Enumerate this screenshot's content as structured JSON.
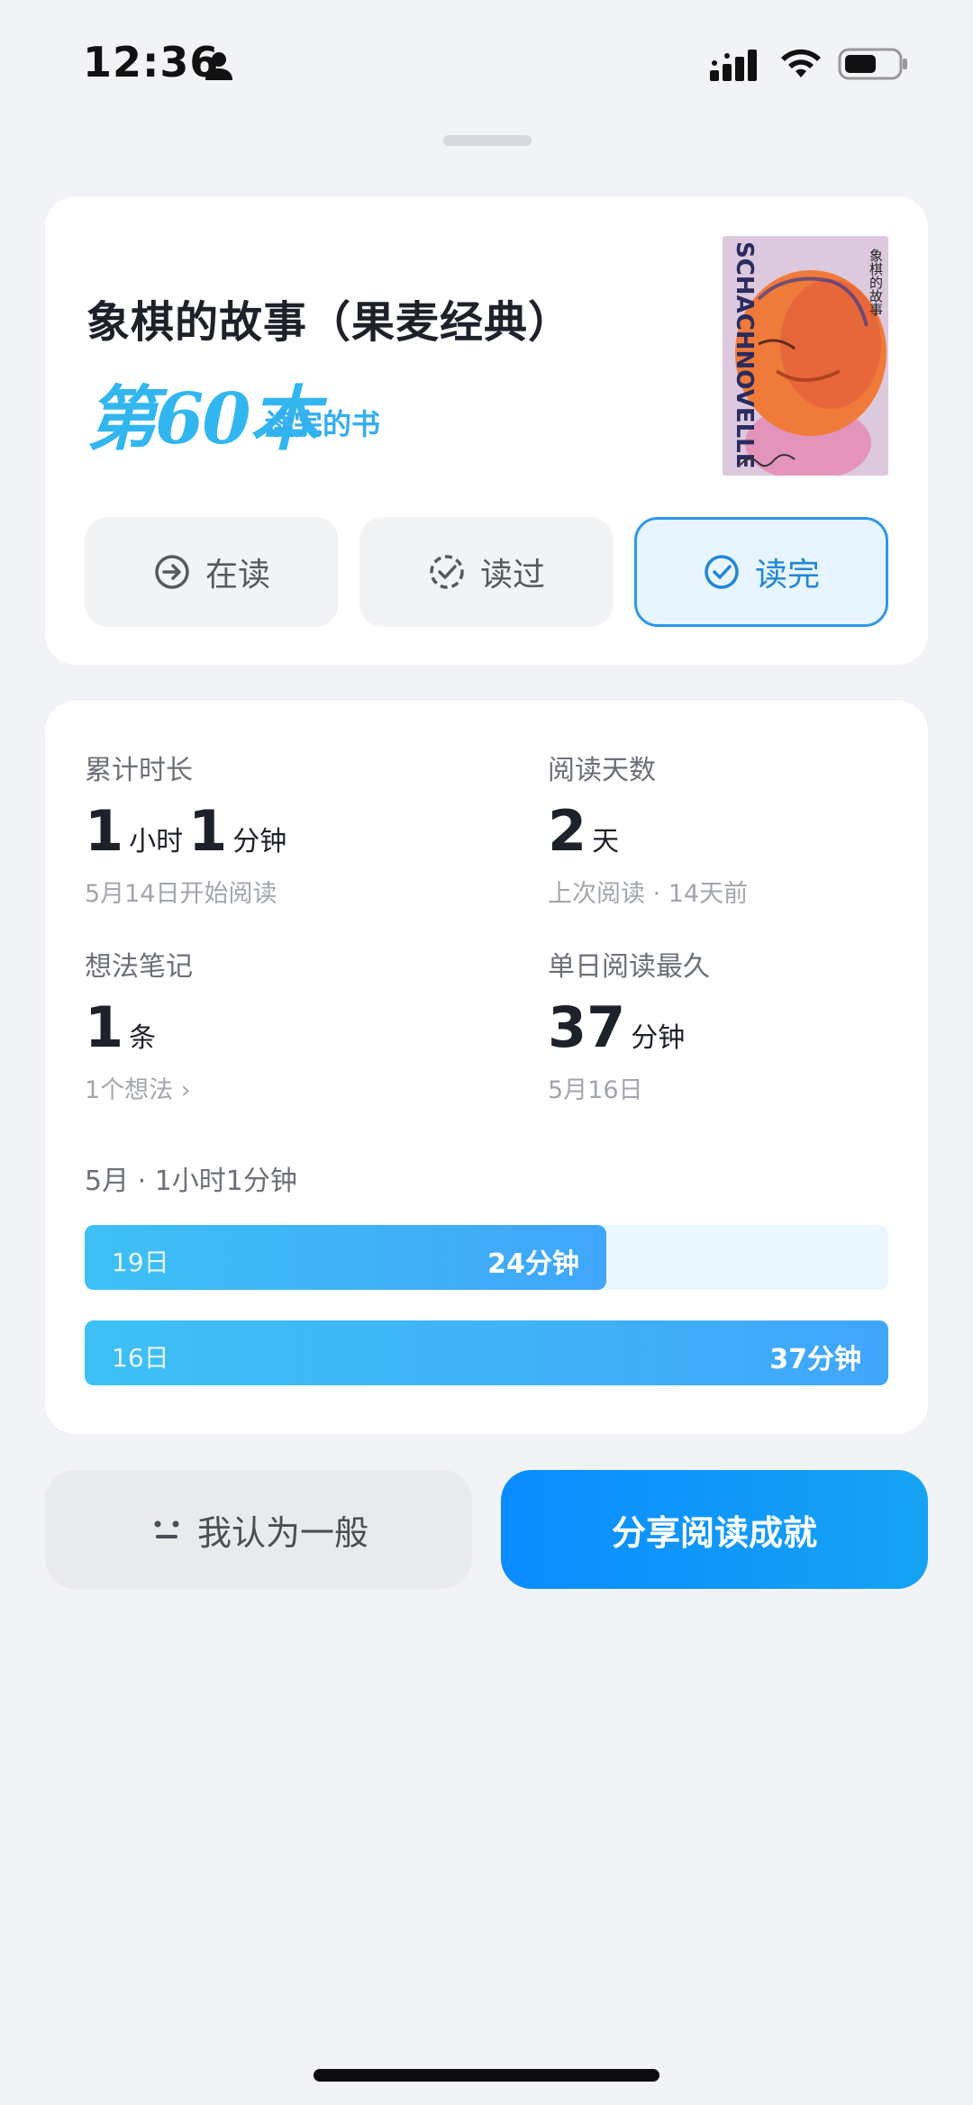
{
  "status_bar": {
    "time": "12:36",
    "icons": [
      "person-icon",
      "signal-icon",
      "wifi-icon",
      "battery-icon"
    ]
  },
  "book": {
    "title": "象棋的故事（果麦经典）",
    "rank": "第60本",
    "rank_suffix": "读完的书",
    "cover": {
      "spine_text": "SCHACHNOVELLE",
      "title": "象棋的故事"
    }
  },
  "status_buttons": [
    {
      "label": "在读",
      "icon": "arrow-circle-icon",
      "selected": false
    },
    {
      "label": "读过",
      "icon": "dashed-check-circle-icon",
      "selected": false
    },
    {
      "label": "读完",
      "icon": "check-circle-icon",
      "selected": true
    }
  ],
  "stats": {
    "total_time": {
      "label": "累计时长",
      "hours": "1",
      "hours_unit": "小时",
      "minutes": "1",
      "minutes_unit": "分钟",
      "sub": "5月14日开始阅读"
    },
    "reading_days": {
      "label": "阅读天数",
      "value": "2",
      "unit": "天",
      "sub": "上次阅读 · 14天前"
    },
    "notes": {
      "label": "想法笔记",
      "value": "1",
      "unit": "条",
      "sub": "1个想法 ›"
    },
    "longest_day": {
      "label": "单日阅读最久",
      "value": "37",
      "unit": "分钟",
      "sub": "5月16日"
    }
  },
  "monthly": {
    "label": "5月 · 1小时1分钟",
    "bars": [
      {
        "day": "19日",
        "duration": "24分钟",
        "fraction": 0.649
      },
      {
        "day": "16日",
        "duration": "37分钟",
        "fraction": 1.0
      }
    ]
  },
  "actions": {
    "meh_label": "我认为一般",
    "share_label": "分享阅读成就"
  },
  "colors": {
    "accent": "#1f86d9",
    "rank": "#32b6f0",
    "share_gradient_start": "#0a8bff",
    "share_gradient_end": "#16a3f3",
    "bar_fill": "#3ec0f6",
    "bar_track": "#eaf7fe"
  }
}
